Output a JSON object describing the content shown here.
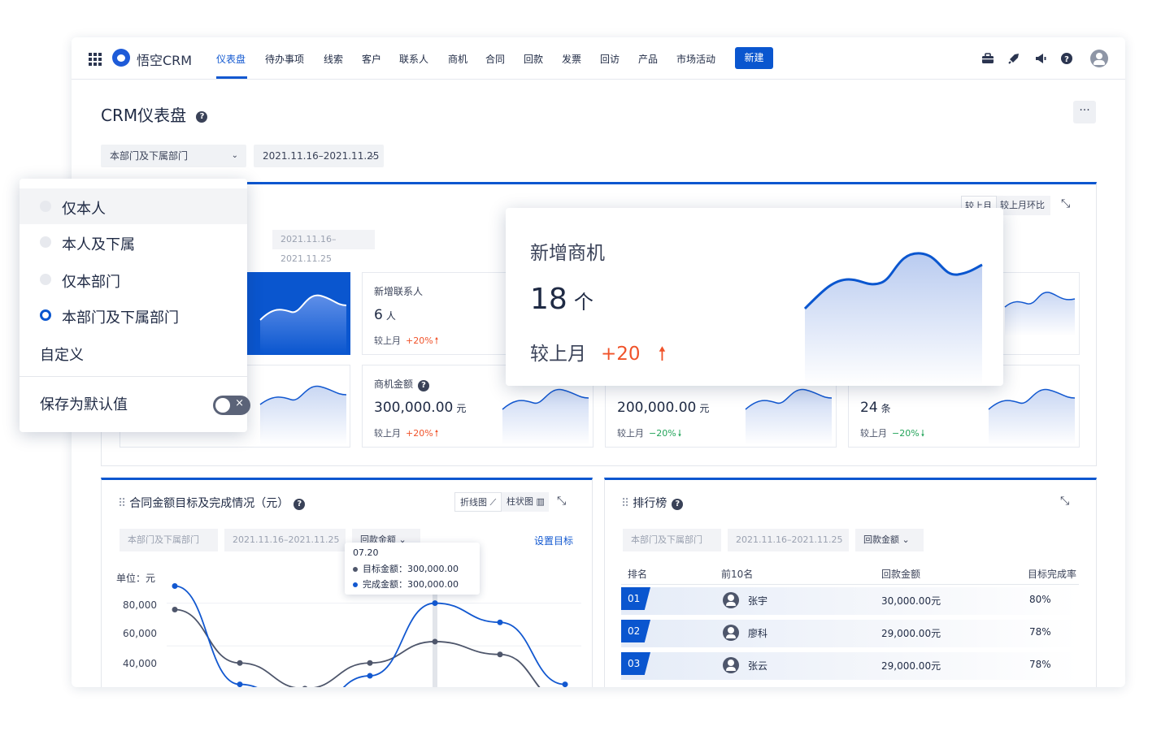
{
  "brand": {
    "name": "悟空CRM"
  },
  "nav": {
    "items": [
      "仪表盘",
      "待办事项",
      "线索",
      "客户",
      "联系人",
      "商机",
      "合同",
      "回款",
      "发票",
      "回访",
      "产品",
      "市场活动"
    ],
    "new_label": "新建"
  },
  "page": {
    "title": "CRM仪表盘",
    "more": "···"
  },
  "filters": {
    "dept": "本部门及下属部门",
    "range": "2021.11.16–2021.11.25"
  },
  "summary": {
    "range": "2021.11.16–2021.11.25",
    "seg_last_month": "较上月",
    "seg_mom": "较上月环比",
    "cards": [
      {
        "label": "新增联系人",
        "value": "6",
        "unit": "人",
        "cmp": "较上月",
        "change": "+20%",
        "dir": "up"
      },
      {
        "label": "商机金额",
        "value": "300,000.00",
        "unit": "元",
        "cmp": "较上月",
        "change": "+20%",
        "dir": "up"
      },
      {
        "label": "",
        "value": "200,000.00",
        "unit": "元",
        "cmp": "较上月",
        "change": "−20%",
        "dir": "down"
      },
      {
        "label": "",
        "value": "24",
        "unit": "条",
        "cmp": "较上月",
        "change": "−20%",
        "dir": "down"
      }
    ]
  },
  "popup": {
    "title": "新增商机",
    "value": "18",
    "unit": "个",
    "cmp": "较上月",
    "change": "+20"
  },
  "dropdown": {
    "options": [
      "仅本人",
      "本人及下属",
      "仅本部门",
      "本部门及下属部门",
      "自定义"
    ],
    "selected": "本部门及下属部门",
    "save_default": "保存为默认值"
  },
  "contract": {
    "title": "合同金额目标及完成情况（元）",
    "seg_line": "折线图",
    "seg_bar": "柱状图",
    "dept": "本部门及下属部门",
    "range": "2021.11.16–2021.11.25",
    "metric": "回款金额",
    "set_target": "设置目标",
    "unit_label": "单位：元",
    "tooltip": {
      "date": "07.20",
      "target_label": "目标金额：",
      "target_value": "300,000.00",
      "done_label": "完成金额：",
      "done_value": "300,000.00"
    }
  },
  "chart_data": {
    "type": "line",
    "ylabel": "单位：元",
    "yticks": [
      "80,000",
      "60,000",
      "40,000"
    ],
    "ylim": [
      35000,
      92000
    ],
    "x": [
      1,
      2,
      3,
      4,
      5,
      6,
      7
    ],
    "series": [
      {
        "name": "目标金额",
        "color": "#4e566b",
        "values": [
          77000,
          52000,
          40000,
          52000,
          62000,
          56000,
          34000
        ]
      },
      {
        "name": "完成金额",
        "color": "#1258d0",
        "values": [
          88000,
          42000,
          29000,
          46000,
          80000,
          71000,
          42000
        ]
      }
    ]
  },
  "ranking": {
    "title": "排行榜",
    "dept": "本部门及下属部门",
    "range": "2021.11.16–2021.11.25",
    "metric": "回款金额",
    "headers": [
      "排名",
      "前10名",
      "回款金额",
      "目标完成率"
    ],
    "rows": [
      {
        "rank": "01",
        "name": "张宇",
        "amount": "30,000.00元",
        "rate": "80%"
      },
      {
        "rank": "02",
        "name": "廖科",
        "amount": "29,000.00元",
        "rate": "78%"
      },
      {
        "rank": "03",
        "name": "张云",
        "amount": "29,000.00元",
        "rate": "78%"
      }
    ]
  },
  "colors": {
    "primary": "#0a56cf",
    "up": "#f0532a",
    "down": "#23a45a"
  }
}
